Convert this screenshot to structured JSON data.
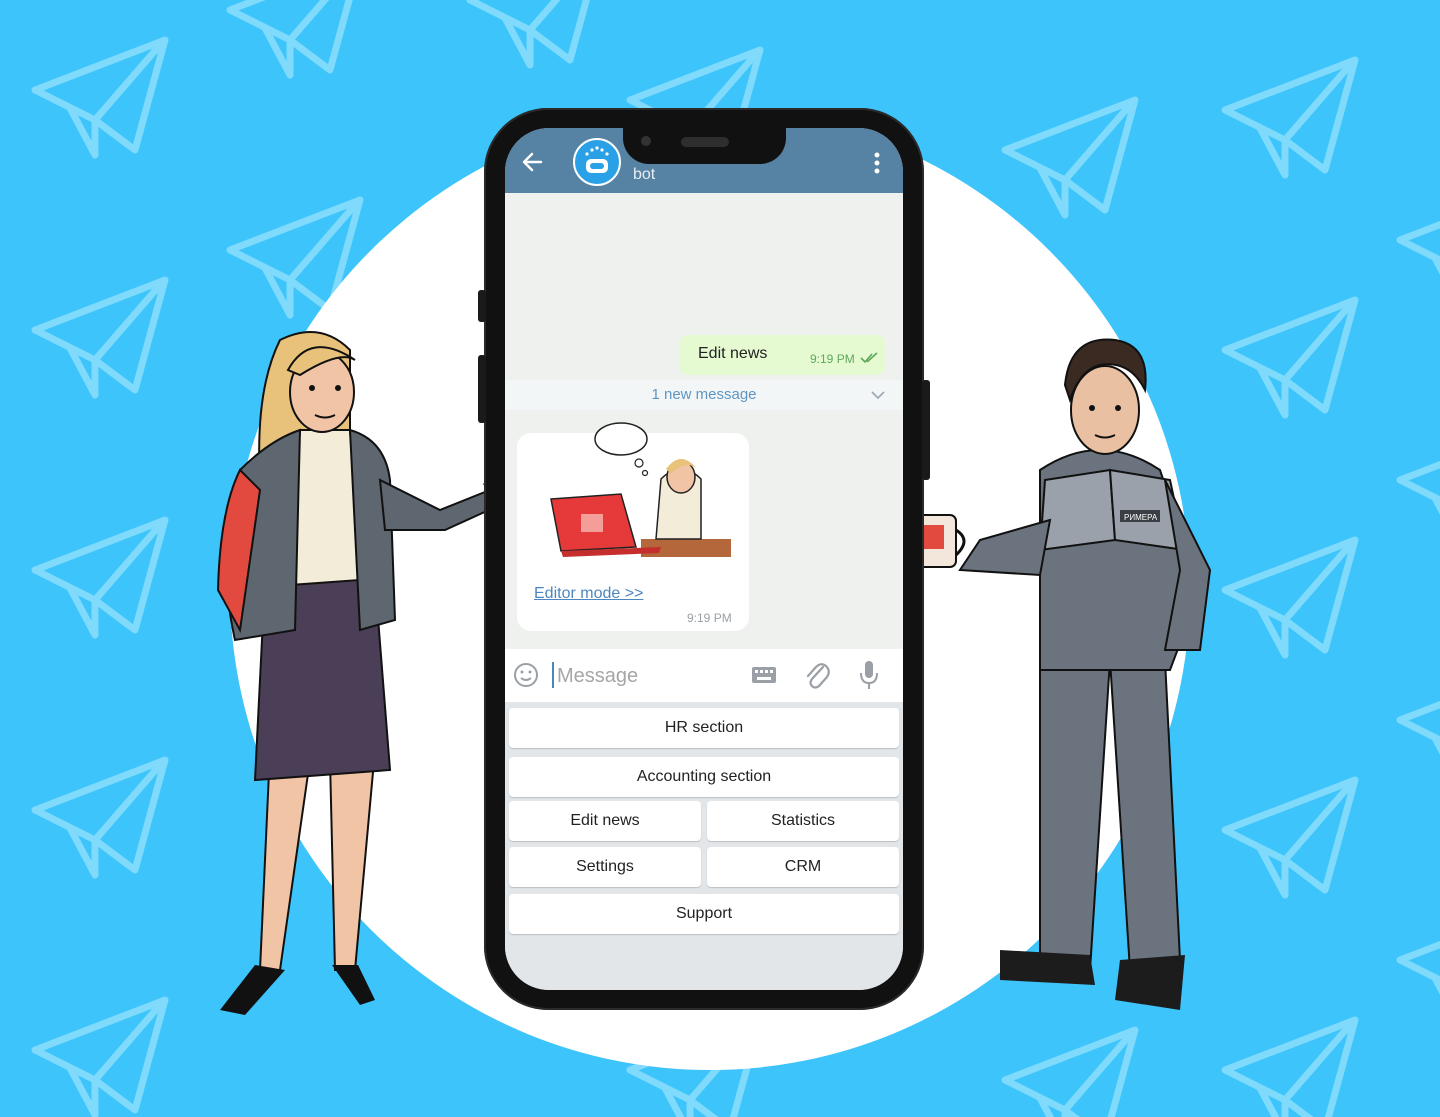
{
  "chat": {
    "title": "bot",
    "colors": {
      "header": "#5682a3",
      "outgoing_bubble": "#e6fad2",
      "link": "#4c86bf",
      "background": "#3cc4fb"
    }
  },
  "messages": {
    "outgoing": {
      "text": "Edit news",
      "time": "9:19 PM",
      "status_icon": "double-check-icon"
    },
    "new_messages_label": "1 new message",
    "incoming": {
      "link_text": "Editor mode >>",
      "time": "9:19 PM"
    }
  },
  "input": {
    "placeholder": "Message"
  },
  "keyboard": {
    "buttons": [
      "HR section",
      "Accounting section",
      "Edit news",
      "Statistics",
      "Settings",
      "CRM",
      "Support"
    ]
  },
  "mug": {
    "brand_text": "РИМЕРА"
  }
}
